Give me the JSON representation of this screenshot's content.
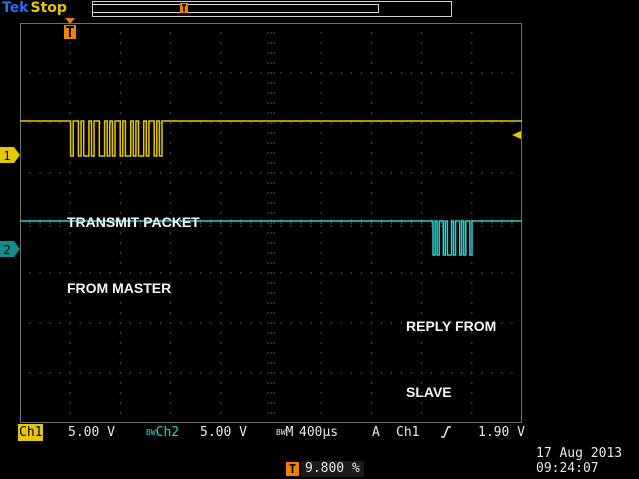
{
  "header": {
    "brand": "Tek",
    "run_state": "Stop"
  },
  "annotations": {
    "transmit_line1": "TRANSMIT PACKET",
    "transmit_line2": "FROM MASTER",
    "reply_line1": "REPLY FROM",
    "reply_line2": "SLAVE"
  },
  "channels": {
    "ch1": {
      "number": "1",
      "color": "#e6c800",
      "label": "Ch1",
      "scale": "5.00 V"
    },
    "ch2": {
      "number": "2",
      "color": "#2ad0d0",
      "label": "Ch2",
      "scale": "5.00 V"
    }
  },
  "status": {
    "bw_symbol": "BW",
    "timebase_label": "M",
    "timebase_value": "400µs",
    "acquisition_mode": "A",
    "trigger_source": "Ch1",
    "trigger_slope_icon": "rising-edge-icon",
    "trigger_level": "1.90 V"
  },
  "trigger": {
    "marker": "T",
    "position": "9.800 %",
    "marker_color": "#f08000"
  },
  "datetime": {
    "date": "17 Aug 2013",
    "time": "09:24:07"
  }
}
